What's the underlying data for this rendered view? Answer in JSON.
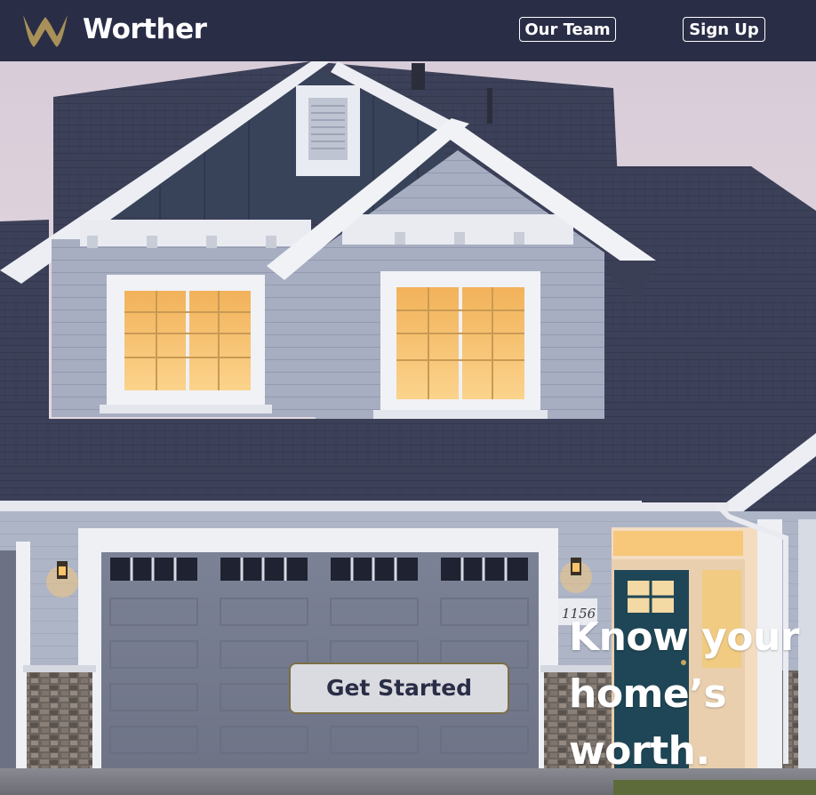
{
  "nav": {
    "brand": "Worther",
    "logo_icon": "crown-w-logo",
    "links": [
      {
        "label": "Our Team"
      },
      {
        "label": "Sign Up"
      }
    ]
  },
  "hero": {
    "image": "house-photo",
    "headline": "Know your home’s worth.",
    "cta_label": "Get Started",
    "house_number": "1156"
  },
  "colors": {
    "nav_bg": "#2a2d46",
    "logo_gold": "#a89058",
    "button_bg": "#dadbe0",
    "button_border": "#7c6e45",
    "button_text": "#2a2d46"
  }
}
